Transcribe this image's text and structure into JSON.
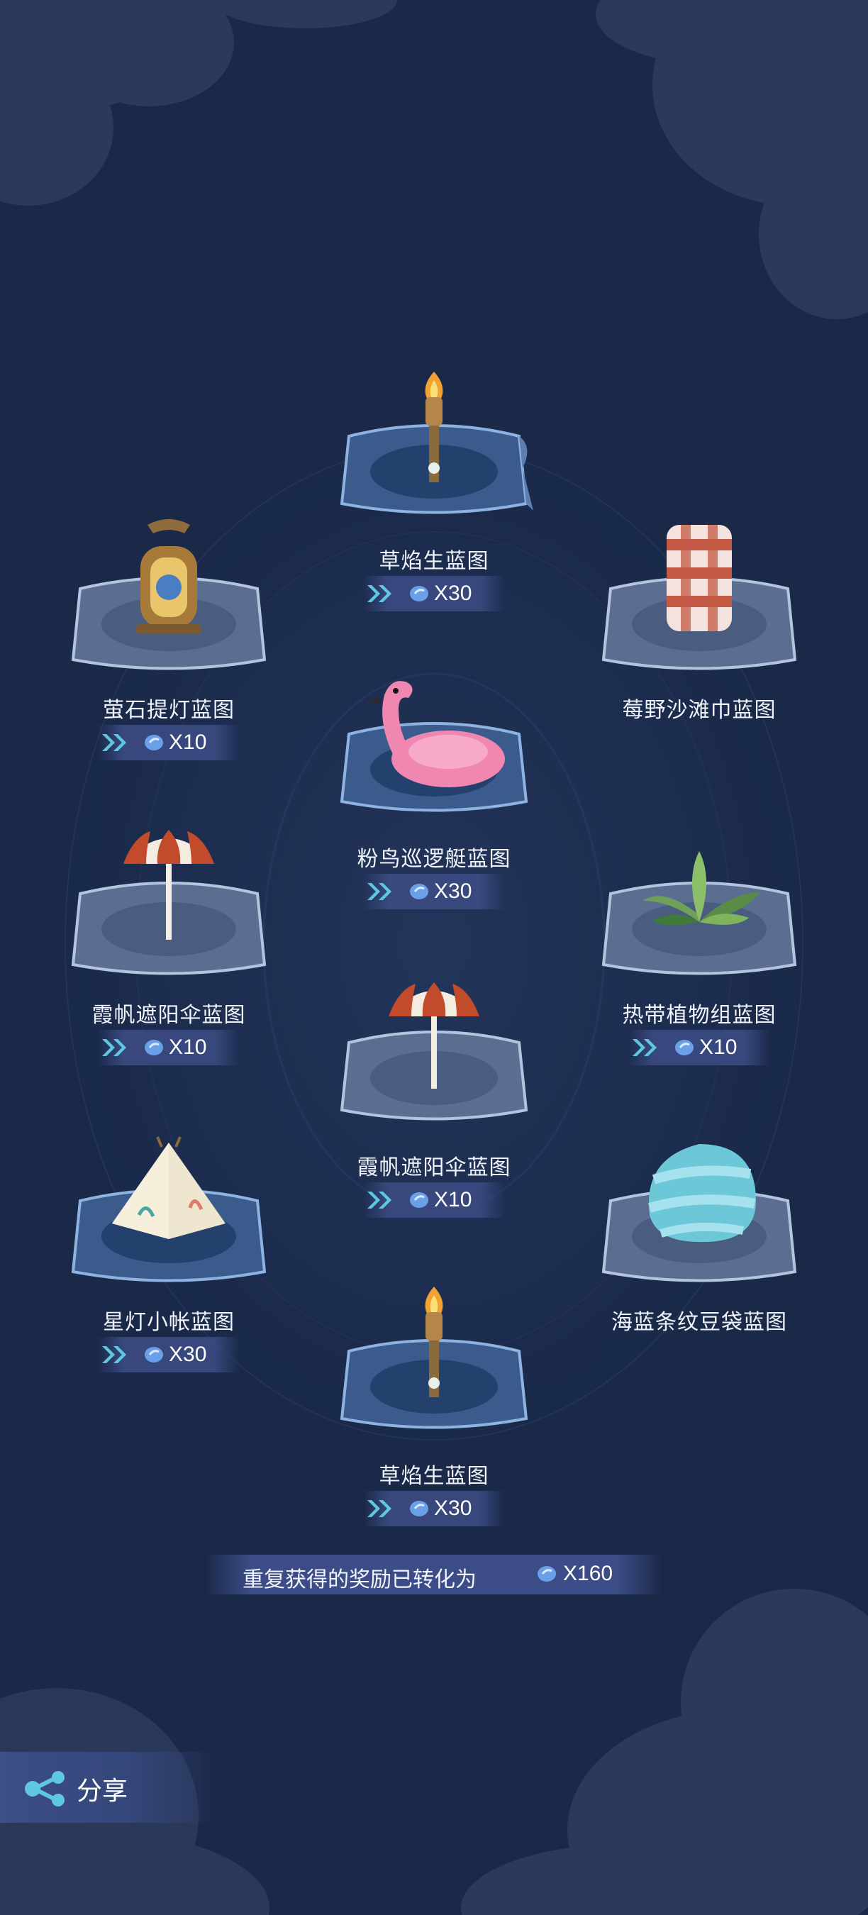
{
  "rewards": [
    {
      "label": "草焰生蓝图",
      "count": "X30",
      "item_icon": "torch-icon"
    },
    {
      "label": "萤石提灯蓝图",
      "count": "X10",
      "item_icon": "lantern-icon"
    },
    {
      "label": "莓野沙滩巾蓝图",
      "count": "",
      "item_icon": "beach-towel-icon"
    },
    {
      "label": "粉鸟巡逻艇蓝图",
      "count": "X30",
      "item_icon": "flamingo-float-icon"
    },
    {
      "label": "霞帆遮阳伞蓝图",
      "count": "X10",
      "item_icon": "parasol-icon"
    },
    {
      "label": "热带植物组蓝图",
      "count": "X10",
      "item_icon": "tropical-plants-icon"
    },
    {
      "label": "霞帆遮阳伞蓝图",
      "count": "X10",
      "item_icon": "parasol-icon"
    },
    {
      "label": "星灯小帐蓝图",
      "count": "X30",
      "item_icon": "tent-icon"
    },
    {
      "label": "海蓝条纹豆袋蓝图",
      "count": "",
      "item_icon": "beanbag-icon"
    },
    {
      "label": "草焰生蓝图",
      "count": "X30",
      "item_icon": "torch-icon"
    }
  ],
  "summary": {
    "text": "重复获得的奖励已转化为",
    "count": "X160",
    "currency_icon": "blue-gem-icon"
  },
  "share": {
    "label": "分享",
    "icon": "share-icon"
  },
  "colors": {
    "background": "#1b2a4b",
    "chip": "#3a4a80",
    "chevron": "#5fc8e0",
    "gem": "#6aa0e8",
    "text": "#f1f4fb"
  }
}
